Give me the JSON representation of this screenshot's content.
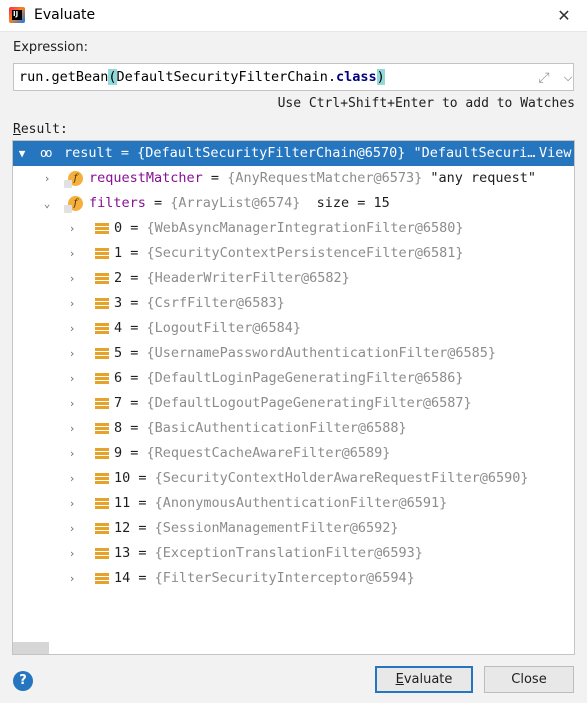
{
  "window": {
    "title": "Evaluate",
    "close_glyph": "✕"
  },
  "expression": {
    "label": "Expression:",
    "prefix": "run.getBean",
    "open_paren": "(",
    "argument": "DefaultSecurityFilterChain.",
    "keyword": "class",
    "close_paren": ")",
    "expand_icon": "expand-icon",
    "dropdown_icon": "chevron-down-icon"
  },
  "hint": "Use Ctrl+Shift+Enter to add to Watches",
  "result_label": {
    "mnemonic": "R",
    "rest": "esult:"
  },
  "tree": {
    "root": {
      "name": "result",
      "eq": " = ",
      "value": "{DefaultSecurityFilterChain@6570} \"DefaultSecuri…",
      "link": "View"
    },
    "request_matcher": {
      "icon": "f",
      "name": "requestMatcher",
      "eq": " = ",
      "value": "{AnyRequestMatcher@6573}",
      "str": " \"any request\""
    },
    "filters": {
      "icon": "f",
      "name": "filters",
      "eq": " = ",
      "value": "{ArrayList@6574}",
      "size": "  size = 15"
    },
    "items": [
      {
        "index": "0",
        "value": "{WebAsyncManagerIntegrationFilter@6580}"
      },
      {
        "index": "1",
        "value": "{SecurityContextPersistenceFilter@6581}"
      },
      {
        "index": "2",
        "value": "{HeaderWriterFilter@6582}"
      },
      {
        "index": "3",
        "value": "{CsrfFilter@6583}"
      },
      {
        "index": "4",
        "value": "{LogoutFilter@6584}"
      },
      {
        "index": "5",
        "value": "{UsernamePasswordAuthenticationFilter@6585}"
      },
      {
        "index": "6",
        "value": "{DefaultLoginPageGeneratingFilter@6586}"
      },
      {
        "index": "7",
        "value": "{DefaultLogoutPageGeneratingFilter@6587}"
      },
      {
        "index": "8",
        "value": "{BasicAuthenticationFilter@6588}"
      },
      {
        "index": "9",
        "value": "{RequestCacheAwareFilter@6589}"
      },
      {
        "index": "10",
        "value": "{SecurityContextHolderAwareRequestFilter@6590}"
      },
      {
        "index": "11",
        "value": "{AnonymousAuthenticationFilter@6591}"
      },
      {
        "index": "12",
        "value": "{SessionManagementFilter@6592}"
      },
      {
        "index": "13",
        "value": "{ExceptionTranslationFilter@6593}"
      },
      {
        "index": "14",
        "value": "{FilterSecurityInterceptor@6594}"
      }
    ],
    "eq": " = "
  },
  "buttons": {
    "help": "?",
    "evaluate_mnemonic": "E",
    "evaluate_rest": "valuate",
    "close": "Close"
  },
  "colors": {
    "selection": "#2675bf",
    "field_name": "#871094",
    "string": "#067d17",
    "field_icon": "#f4af3d"
  }
}
